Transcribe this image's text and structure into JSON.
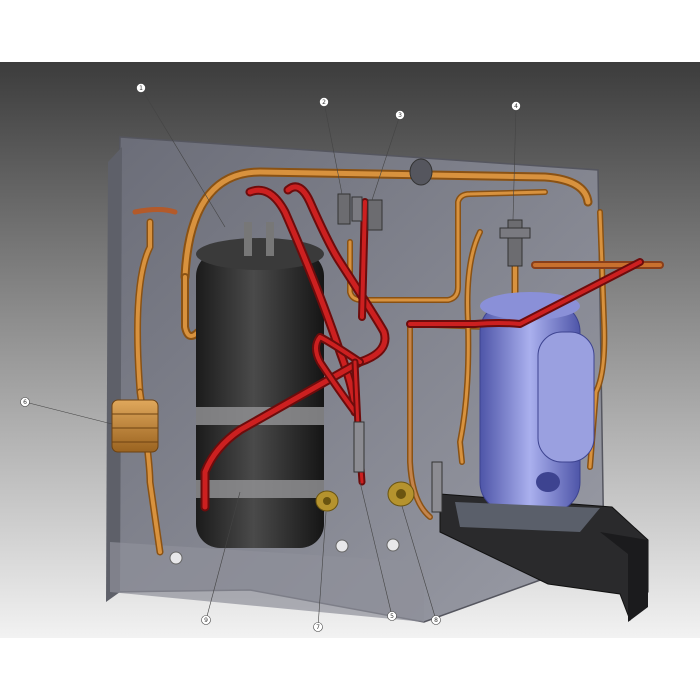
{
  "figure": {
    "background": {
      "top": "#3c3c3c",
      "bottom": "#f2f2f2"
    },
    "colors": {
      "copper": "#c8822e",
      "copper_dark": "#8a5214",
      "red_pipe": "#b51d1d",
      "tank": "#2a2a2a",
      "compressor": "#6f76c9",
      "panel": "#7d7f8a"
    },
    "callouts": [
      {
        "number": "1",
        "target": "tank-top"
      },
      {
        "number": "2",
        "target": "valve-left"
      },
      {
        "number": "3",
        "target": "valve-right"
      },
      {
        "number": "4",
        "target": "compressor-valve"
      },
      {
        "number": "5",
        "target": "lower-red-pipe"
      },
      {
        "number": "6",
        "target": "side-coil"
      },
      {
        "number": "7",
        "target": "left-brass-fitting"
      },
      {
        "number": "8",
        "target": "right-brass-fitting"
      },
      {
        "number": "9",
        "target": "tank-body"
      }
    ]
  }
}
